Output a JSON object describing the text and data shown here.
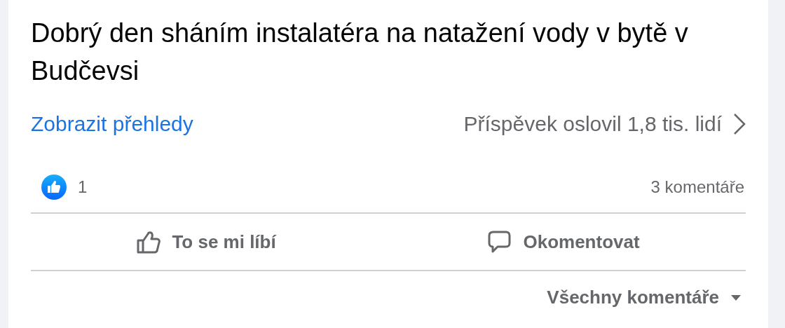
{
  "post": {
    "text": "Dobrý den sháním instalatéra na natažení vody v bytě v Budčevsi"
  },
  "insights": {
    "link": "Zobrazit přehledy",
    "reach": "Příspěvek oslovil 1,8 tis. lidí"
  },
  "reactions": {
    "count": "1",
    "comments": "3 komentáře"
  },
  "actions": [
    {
      "kind": "like",
      "label": "To se mi líbí"
    },
    {
      "kind": "comment",
      "label": "Okomentovat"
    }
  ],
  "comment_filter": {
    "label": "Všechny komentáře"
  }
}
